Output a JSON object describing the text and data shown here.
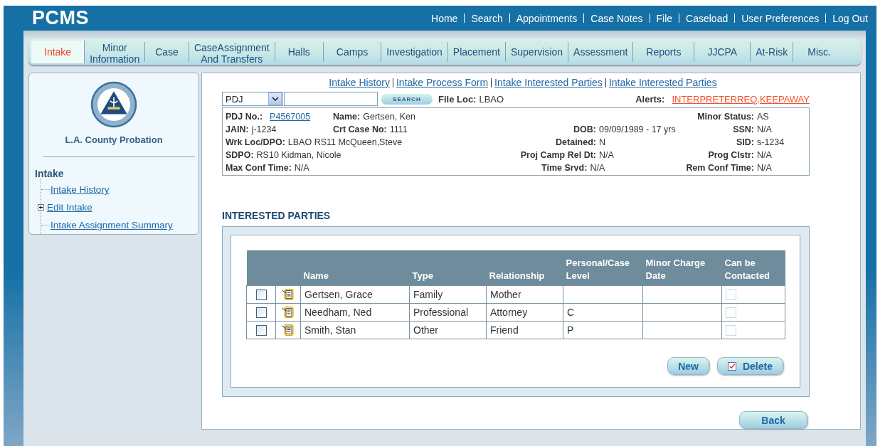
{
  "app": {
    "logo": "PCMS"
  },
  "top_nav": [
    "Home",
    "Search",
    "Appointments",
    "Case Notes",
    "File",
    "Caseload",
    "User Preferences",
    "Log Out"
  ],
  "tabs": [
    {
      "label": "Intake",
      "selected": true
    },
    {
      "label": "Minor\nInformation",
      "selected": false
    },
    {
      "label": "Case",
      "selected": false
    },
    {
      "label": "CaseAssignment\nAnd Transfers",
      "selected": false
    },
    {
      "label": "Halls",
      "selected": false
    },
    {
      "label": "Camps",
      "selected": false
    },
    {
      "label": "Investigation",
      "selected": false
    },
    {
      "label": "Placement",
      "selected": false
    },
    {
      "label": "Supervision",
      "selected": false
    },
    {
      "label": "Assessment",
      "selected": false
    },
    {
      "label": "Reports",
      "selected": false
    },
    {
      "label": "JJCPA",
      "selected": false
    },
    {
      "label": "At-Risk",
      "selected": false
    },
    {
      "label": "Misc.",
      "selected": false
    }
  ],
  "sidebar": {
    "agency": "L.A. County Probation",
    "tree": {
      "label": "Intake",
      "children": [
        {
          "label": "Intake History"
        },
        {
          "label": "Edit Intake",
          "expanded": false
        },
        {
          "label": "Intake Assignment Summary"
        }
      ]
    }
  },
  "sub_links": [
    "Intake History",
    "Intake Process Form",
    "Intake Interested Parties",
    "Intake Interested Parties"
  ],
  "search": {
    "type_value": "PDJ",
    "button": "SEARCH",
    "file_loc_label": "File Loc:",
    "file_loc": "LBAO",
    "alerts_label": "Alerts:",
    "alerts": "INTERPRETERREQ,KEEPAWAY"
  },
  "minor_info": [
    {
      "left": [
        {
          "label": "PDJ No.:",
          "value": "P4567005",
          "kind": "link"
        },
        {
          "label": "Name:",
          "value": "Gertsen, Ken",
          "kind": "text"
        }
      ],
      "far": {
        "label": "Minor Status:",
        "value": "AS"
      }
    },
    {
      "left": [
        {
          "label": "JAIN:",
          "value": "j-1234",
          "kind": "text"
        },
        {
          "label": "Crt Case No:",
          "value": "1111",
          "kind": "text"
        }
      ],
      "middle": {
        "label": "DOB:",
        "value": "09/09/1989 - 17 yrs"
      },
      "far": {
        "label": "SSN:",
        "value": "N/A"
      }
    },
    {
      "left": [
        {
          "label": "Wrk Loc/DPO:",
          "value": "LBAO RS11 McQueen,Steve",
          "kind": "text"
        }
      ],
      "middle": {
        "label": "Detained:",
        "value": "N"
      },
      "far": {
        "label": "SID:",
        "value": "s-1234"
      }
    },
    {
      "left": [
        {
          "label": "SDPO:",
          "value": "RS10 Kidman, Nicole",
          "kind": "text"
        }
      ],
      "middle": {
        "label": "Proj Camp Rel Dt:",
        "value": "N/A"
      },
      "far": {
        "label": "Prog Clstr:",
        "value": "N/A"
      }
    },
    {
      "left": [
        {
          "label": "Max Conf Time:",
          "value": "N/A",
          "kind": "text"
        }
      ],
      "middle": {
        "label": "Time Srvd:",
        "value": "N/A"
      },
      "far": {
        "label": "Rem Conf Time:",
        "value": "N/A"
      }
    }
  ],
  "interested_parties": {
    "title": "INTERESTED PARTIES",
    "columns": [
      "Name",
      "Type",
      "Relationship",
      "Personal/Case Level",
      "Minor Charge Date",
      "Can be Contacted"
    ],
    "rows": [
      {
        "checked": false,
        "name": "Gertsen, Grace",
        "type": "Family",
        "relationship": "Mother",
        "level": "",
        "minor_charge_date": "",
        "can_be_contacted": {
          "checked": false,
          "disabled": true
        }
      },
      {
        "checked": false,
        "name": "Needham, Ned",
        "type": "Professional",
        "relationship": "Attorney",
        "level": "C",
        "minor_charge_date": "",
        "can_be_contacted": {
          "checked": false,
          "disabled": true
        }
      },
      {
        "checked": false,
        "name": "Smith, Stan",
        "type": "Other",
        "relationship": "Friend",
        "level": "P",
        "minor_charge_date": "",
        "can_be_contacted": {
          "checked": false,
          "disabled": true
        }
      }
    ],
    "buttons": [
      "New",
      "Delete"
    ]
  },
  "back_button": "Back"
}
